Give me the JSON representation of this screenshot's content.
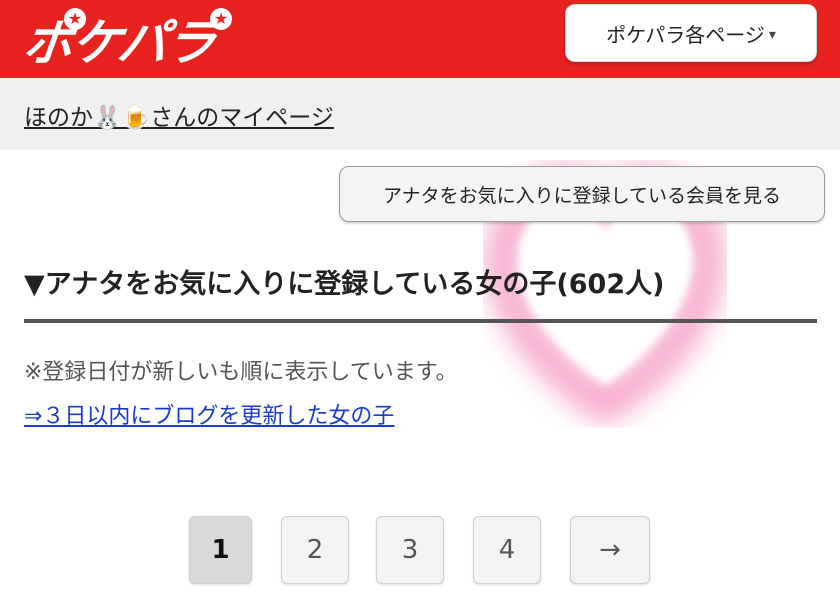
{
  "header": {
    "logo_text": "ポケパラ",
    "pages_menu_label": "ポケパラ各ページ",
    "pages_menu_arrow": "▾"
  },
  "mypage": {
    "link_text": "ほのか🐰🍺さんのマイページ"
  },
  "favorites": {
    "view_button_label": "アナタをお気に入りに登録している会員を見る",
    "section_title": "▼アナタをお気に入りに登録している女の子(602人)",
    "note": "※登録日付が新しいも順に表示しています。",
    "blog_link": "⇒３日以内にブログを更新した女の子"
  },
  "pagination": {
    "current": 1,
    "pages": [
      "1",
      "2",
      "3",
      "4"
    ],
    "next_label": "→"
  },
  "colors": {
    "brand_red": "#e8231f",
    "link_blue": "#1a3cc8"
  }
}
